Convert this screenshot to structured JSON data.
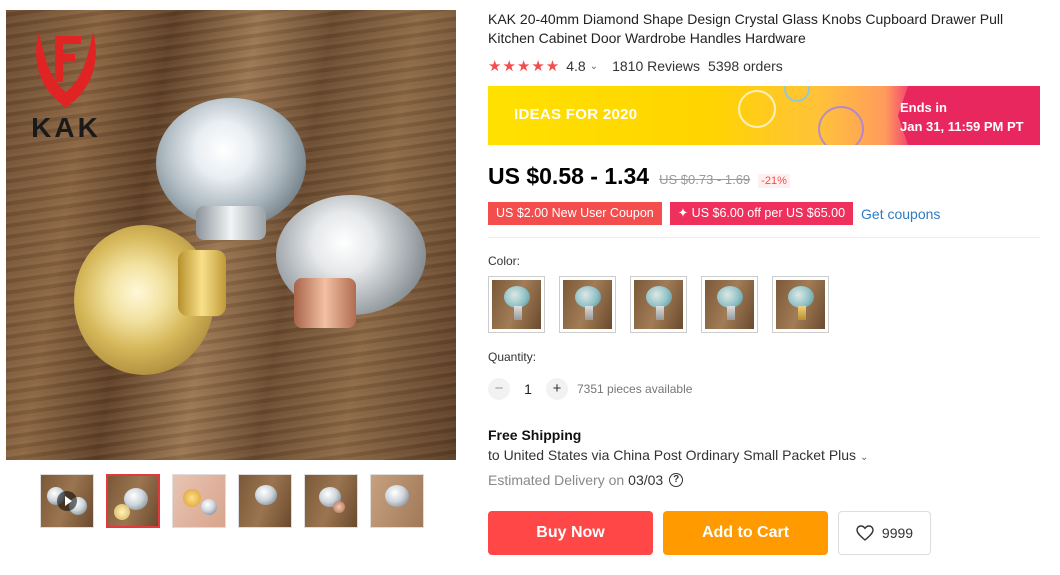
{
  "brand": {
    "logo_letter": "F",
    "logo_text": "KAK"
  },
  "product": {
    "title": "KAK 20-40mm Diamond Shape Design Crystal Glass Knobs Cupboard Drawer Pull Kitchen Cabinet Door Wardrobe Handles Hardware",
    "rating": "4.8",
    "stars_filled": 5,
    "reviews": "1810 Reviews",
    "orders": "5398 orders"
  },
  "promo": {
    "campaign": "IDEAS FOR 2020",
    "ends_label": "Ends in",
    "ends_time": "Jan 31, 11:59 PM PT"
  },
  "price": {
    "current": "US $0.58 - 1.34",
    "original": "US $0.73 - 1.69",
    "discount": "-21%"
  },
  "coupons": {
    "new_user": "US $2.00 New User Coupon",
    "store": "✦ US $6.00 off per US $65.00",
    "get_link": "Get coupons"
  },
  "options": {
    "color_label": "Color:",
    "swatch_count": 5
  },
  "quantity": {
    "label": "Quantity:",
    "minus": "−",
    "value": "1",
    "plus": "+",
    "available": "7351 pieces available"
  },
  "shipping": {
    "title": "Free Shipping",
    "route": "to United States via China Post Ordinary Small Packet Plus",
    "delivery_label": "Estimated Delivery on",
    "delivery_date": "03/03"
  },
  "actions": {
    "buy_now": "Buy Now",
    "add_to_cart": "Add to Cart",
    "wishlist_count": "9999"
  },
  "gallery": {
    "thumbnail_count": 6,
    "active_index": 1
  },
  "colors": {
    "accent_red": "#ff4747",
    "cart_orange": "#ff9a00",
    "star_red": "#f44d4d",
    "link_blue": "#2e7bc4"
  }
}
